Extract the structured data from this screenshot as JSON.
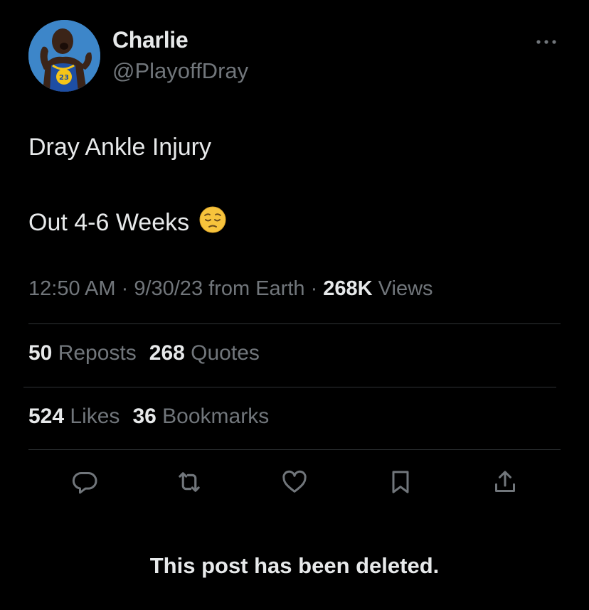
{
  "user": {
    "display_name": "Charlie",
    "handle": "@PlayoffDray",
    "avatar": "avatar-player-jersey-23",
    "jersey_number": "23"
  },
  "tweet": {
    "line1": "Dray Ankle Injury",
    "line2": "Out 4-6 Weeks",
    "emoji": "pensive-face-emoji"
  },
  "meta": {
    "time": "12:50 AM",
    "sep1": " · ",
    "date": "9/30/23",
    "source": " from Earth",
    "sep2": " · ",
    "views_count": "268K",
    "views_label": " Views"
  },
  "stats": {
    "reposts_count": "50",
    "reposts_label": " Reposts",
    "quotes_count": "268",
    "quotes_label": " Quotes",
    "likes_count": "524",
    "likes_label": " Likes",
    "bookmarks_count": "36",
    "bookmarks_label": " Bookmarks"
  },
  "actions": {
    "reply_icon": "reply-icon",
    "repost_icon": "repost-icon",
    "like_icon": "like-icon",
    "bookmark_icon": "bookmark-icon",
    "share_icon": "share-icon"
  },
  "notice": {
    "deleted": "This post has been deleted."
  },
  "colors": {
    "background": "#000000",
    "primary_text": "#e7e9ea",
    "secondary_text": "#71767b",
    "divider": "#2f3336",
    "icon": "#71767b"
  }
}
